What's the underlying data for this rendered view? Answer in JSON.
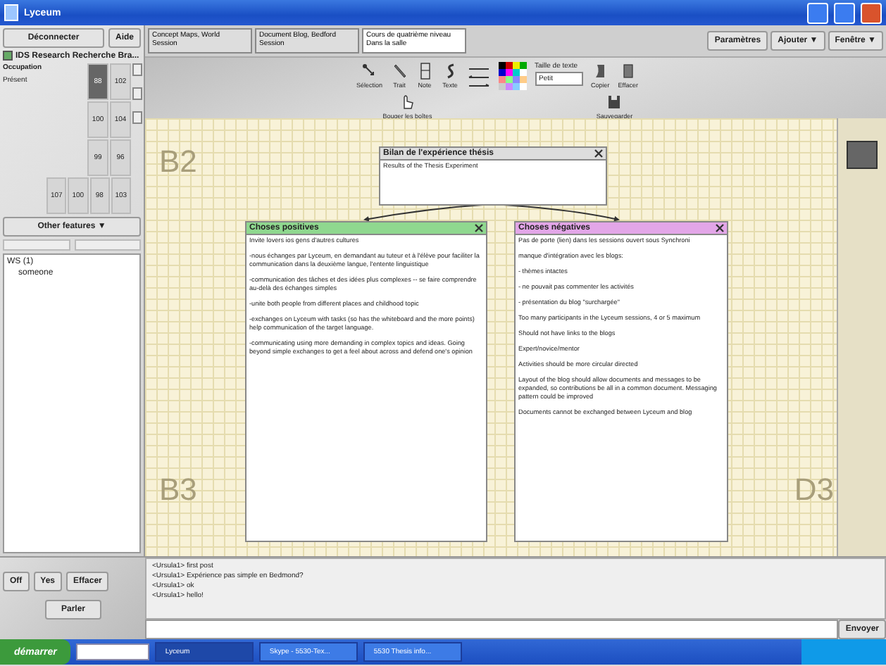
{
  "window": {
    "title": "Lyceum"
  },
  "left_panel": {
    "buttons": [
      "Déconnecter",
      "Aide"
    ],
    "room": {
      "label": "IDS Research Recherche Bra...",
      "checked": true
    },
    "occupancy_label": "Occupation",
    "present_label": "Présent",
    "grid": [
      [
        {
          "text": "88",
          "selected": true
        },
        {
          "text": "102",
          "selected": false
        }
      ],
      [
        {
          "text": "100",
          "selected": false
        },
        {
          "text": "104",
          "selected": false
        }
      ],
      [
        {
          "text": "99",
          "selected": false
        },
        {
          "text": "96",
          "selected": false
        }
      ],
      [
        {
          "text": "107",
          "selected": false
        },
        {
          "text": "100",
          "selected": false
        },
        {
          "text": "98",
          "selected": false
        },
        {
          "text": "103",
          "selected": false
        }
      ]
    ],
    "other_features": "Other features ▼",
    "users": [
      {
        "name": "WS (1)",
        "children": [
          {
            "name": "someone"
          }
        ]
      }
    ]
  },
  "session_tabs": [
    {
      "title": "Concept Maps, World",
      "subtitle": "Session",
      "selected": false
    },
    {
      "title": "Document Blog, Bedford",
      "subtitle": "Session",
      "selected": false
    },
    {
      "title": "Cours de quatrième niveau",
      "subtitle": "Dans la salle",
      "selected": true
    }
  ],
  "menu_buttons": [
    "Paramètres",
    "Ajouter ▼",
    "Fenêtre ▼"
  ],
  "tools": [
    {
      "kind": "select",
      "label": "Sélection"
    },
    {
      "kind": "pen",
      "label": "Trait"
    },
    {
      "kind": "note",
      "label": "Note"
    },
    {
      "kind": "text",
      "label": "Texte"
    }
  ],
  "move_tool": "Bouger les boîtes",
  "text_size": {
    "label": "Taille de texte",
    "value": "Petit"
  },
  "actions": [
    {
      "kind": "copy",
      "label": "Copier"
    },
    {
      "kind": "erase",
      "label": "Effacer"
    }
  ],
  "save": "Sauvegarder",
  "canvas": {
    "zones": {
      "top_left": "B2",
      "bottom_left": "B3",
      "bottom_right": "D3"
    },
    "boxes": [
      {
        "kind": "main",
        "title": "Bilan de l'expérience thésis",
        "lines": [
          "Results of the Thesis Experiment"
        ]
      },
      {
        "kind": "positive",
        "title": "Choses positives",
        "lines": [
          "Invite lovers ios gens d'autres cultures",
          "-nous échanges par Lyceum, en demandant au tuteur et à l'élève pour faciliter la communication dans la deuxième langue, l'entente linguistique",
          "-communication des tâches et des idées plus complexes -- se faire comprendre au-delà des échanges simples",
          "-unite both people from different places and childhood topic",
          "-exchanges on Lyceum with tasks (so has the whiteboard and the more points) help communication of the target language.",
          "-communicating using more demanding in complex topics and ideas. Going beyond simple exchanges to get a feel about across and defend one's opinion"
        ]
      },
      {
        "kind": "negative",
        "title": "Choses négatives",
        "lines": [
          "Pas de porte (lien) dans les sessions ouvert sous Synchroni",
          "manque d'intégration avec les blogs:",
          "- thèmes intactes",
          "- ne pouvait pas commenter les activités",
          "- présentation du blog \"surchargée\"",
          "Too many participants in the Lyceum sessions, 4 or 5 maximum",
          "Should not have links to the blogs",
          "Expert/novice/mentor",
          "Activities should be more circular directed",
          "Layout of the blog should allow documents and messages to be expanded, so contributions be all in a common document. Messaging pattern could be improved",
          "Documents cannot be exchanged between Lyceum and blog"
        ]
      }
    ]
  },
  "chat": {
    "lines": [
      "<Ursula1> first post",
      "<Ursula1> Expérience pas simple en Bedmond?",
      "<Ursula1> ok",
      "<Ursula1> hello!"
    ],
    "send": "Envoyer"
  },
  "voice": {
    "buttons": [
      "Off",
      "Yes",
      "Effacer"
    ],
    "talk": "Parler"
  },
  "taskbar": {
    "start": "démarrer",
    "tasks": [
      {
        "title": "Lyceum",
        "selected": true
      },
      {
        "title": "Skype - 5530-Tex...",
        "selected": false
      },
      {
        "title": "5530 Thesis info...",
        "selected": false
      }
    ]
  }
}
